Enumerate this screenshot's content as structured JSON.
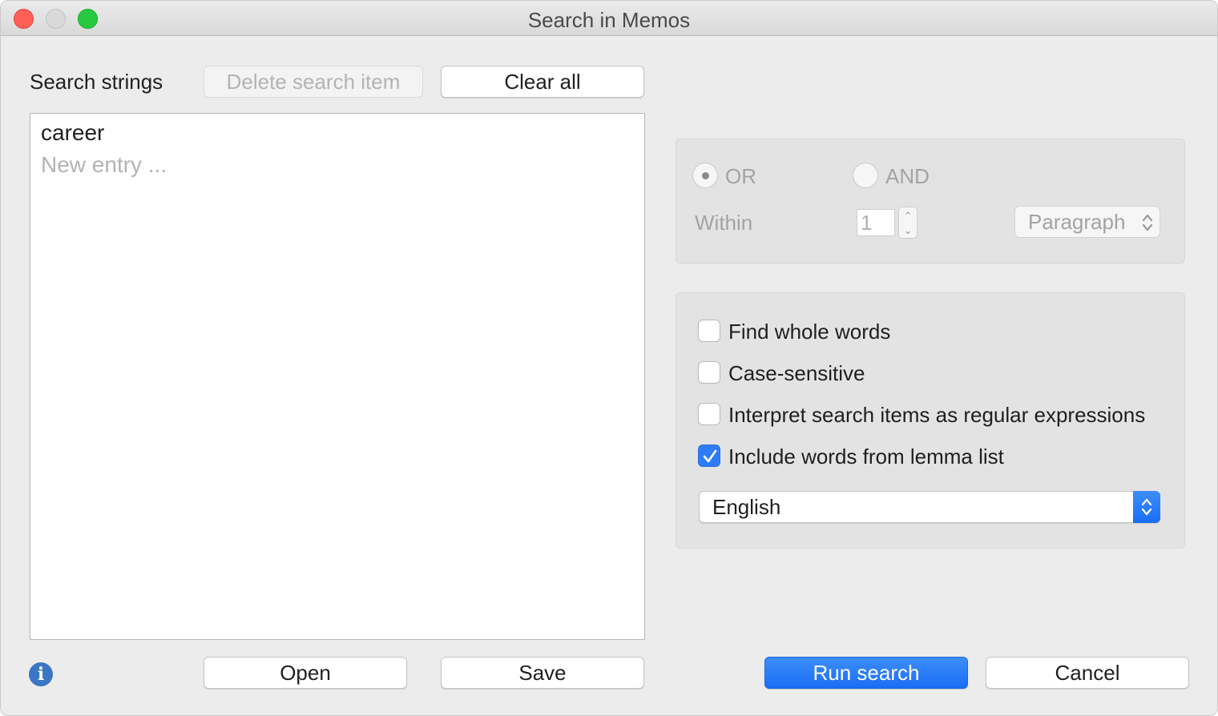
{
  "window": {
    "title": "Search in Memos"
  },
  "search_strings": {
    "label": "Search strings",
    "delete_button": "Delete search item",
    "clear_button": "Clear all",
    "items": [
      "career"
    ],
    "new_entry_placeholder": "New entry ..."
  },
  "combine": {
    "or_label": "OR",
    "and_label": "AND",
    "selected": "OR",
    "within_label": "Within",
    "within_value": "1",
    "unit_value": "Paragraph"
  },
  "options": {
    "whole_words": {
      "label": "Find whole words",
      "checked": false
    },
    "case_sensitive": {
      "label": "Case-sensitive",
      "checked": false
    },
    "regex": {
      "label": "Interpret search items as regular expressions",
      "checked": false
    },
    "lemma": {
      "label": "Include words from lemma list",
      "checked": true
    },
    "language_value": "English"
  },
  "footer": {
    "open_button": "Open",
    "save_button": "Save",
    "run_button": "Run search",
    "cancel_button": "Cancel"
  },
  "colors": {
    "accent": "#2f7cf6",
    "close": "#fe5f57",
    "zoom": "#27c93f"
  }
}
